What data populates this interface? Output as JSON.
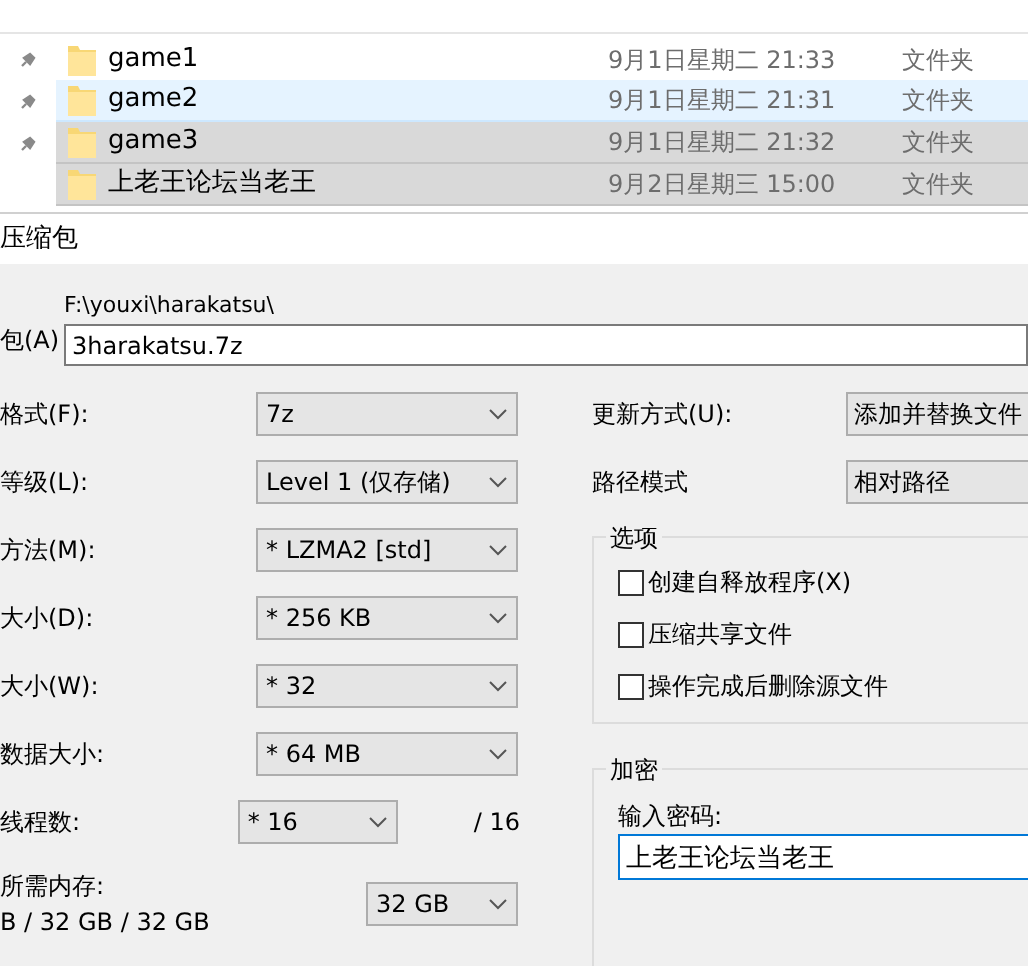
{
  "files": [
    {
      "name": "game1",
      "date": "9月1日星期二 21:33",
      "type": "文件夹",
      "selected": false,
      "hovered": false,
      "pinned": true
    },
    {
      "name": "game2",
      "date": "9月1日星期二 21:31",
      "type": "文件夹",
      "selected": false,
      "hovered": true,
      "pinned": true
    },
    {
      "name": "game3",
      "date": "9月1日星期二 21:32",
      "type": "文件夹",
      "selected": true,
      "hovered": false,
      "pinned": true
    },
    {
      "name": "上老王论坛当老王",
      "date": "9月2日星期三 15:00",
      "type": "文件夹",
      "selected": true,
      "hovered": false,
      "pinned": false
    }
  ],
  "dialog": {
    "title": "压缩包",
    "archive": {
      "label": "包(A)",
      "path": "F:\\youxi\\harakatsu\\",
      "value": "3harakatsu.7z"
    },
    "settings": [
      {
        "label": "格式(F):",
        "value": "7z",
        "kind": "wide"
      },
      {
        "label": "等级(L):",
        "value": "Level 1 (仅存储)",
        "kind": "wide"
      },
      {
        "label": "方法(M):",
        "value": "* LZMA2 [std]",
        "kind": "wide"
      },
      {
        "label": "大小(D):",
        "value": "* 256 KB",
        "kind": "wide"
      },
      {
        "label": "大小(W):",
        "value": "* 32",
        "kind": "wide"
      },
      {
        "label": "数据大小:",
        "value": "* 64 MB",
        "kind": "wide"
      },
      {
        "label": "线程数:",
        "value": "* 16",
        "kind": "narrow",
        "suffix": "/ 16"
      }
    ],
    "memory": {
      "label": "所需内存:",
      "detail": "B / 32 GB / 32 GB",
      "value": "32 GB"
    },
    "update_mode": {
      "label": "更新方式(U):",
      "value": "添加并替换文件"
    },
    "path_mode": {
      "label": "路径模式",
      "value": "相对路径"
    },
    "options": {
      "title": "选项",
      "items": [
        {
          "label": "创建自释放程序(X)",
          "checked": false
        },
        {
          "label": "压缩共享文件",
          "checked": false
        },
        {
          "label": "操作完成后删除源文件",
          "checked": false
        }
      ]
    },
    "encryption": {
      "title": "加密",
      "label": "输入密码:",
      "value": "上老王论坛当老王"
    }
  }
}
